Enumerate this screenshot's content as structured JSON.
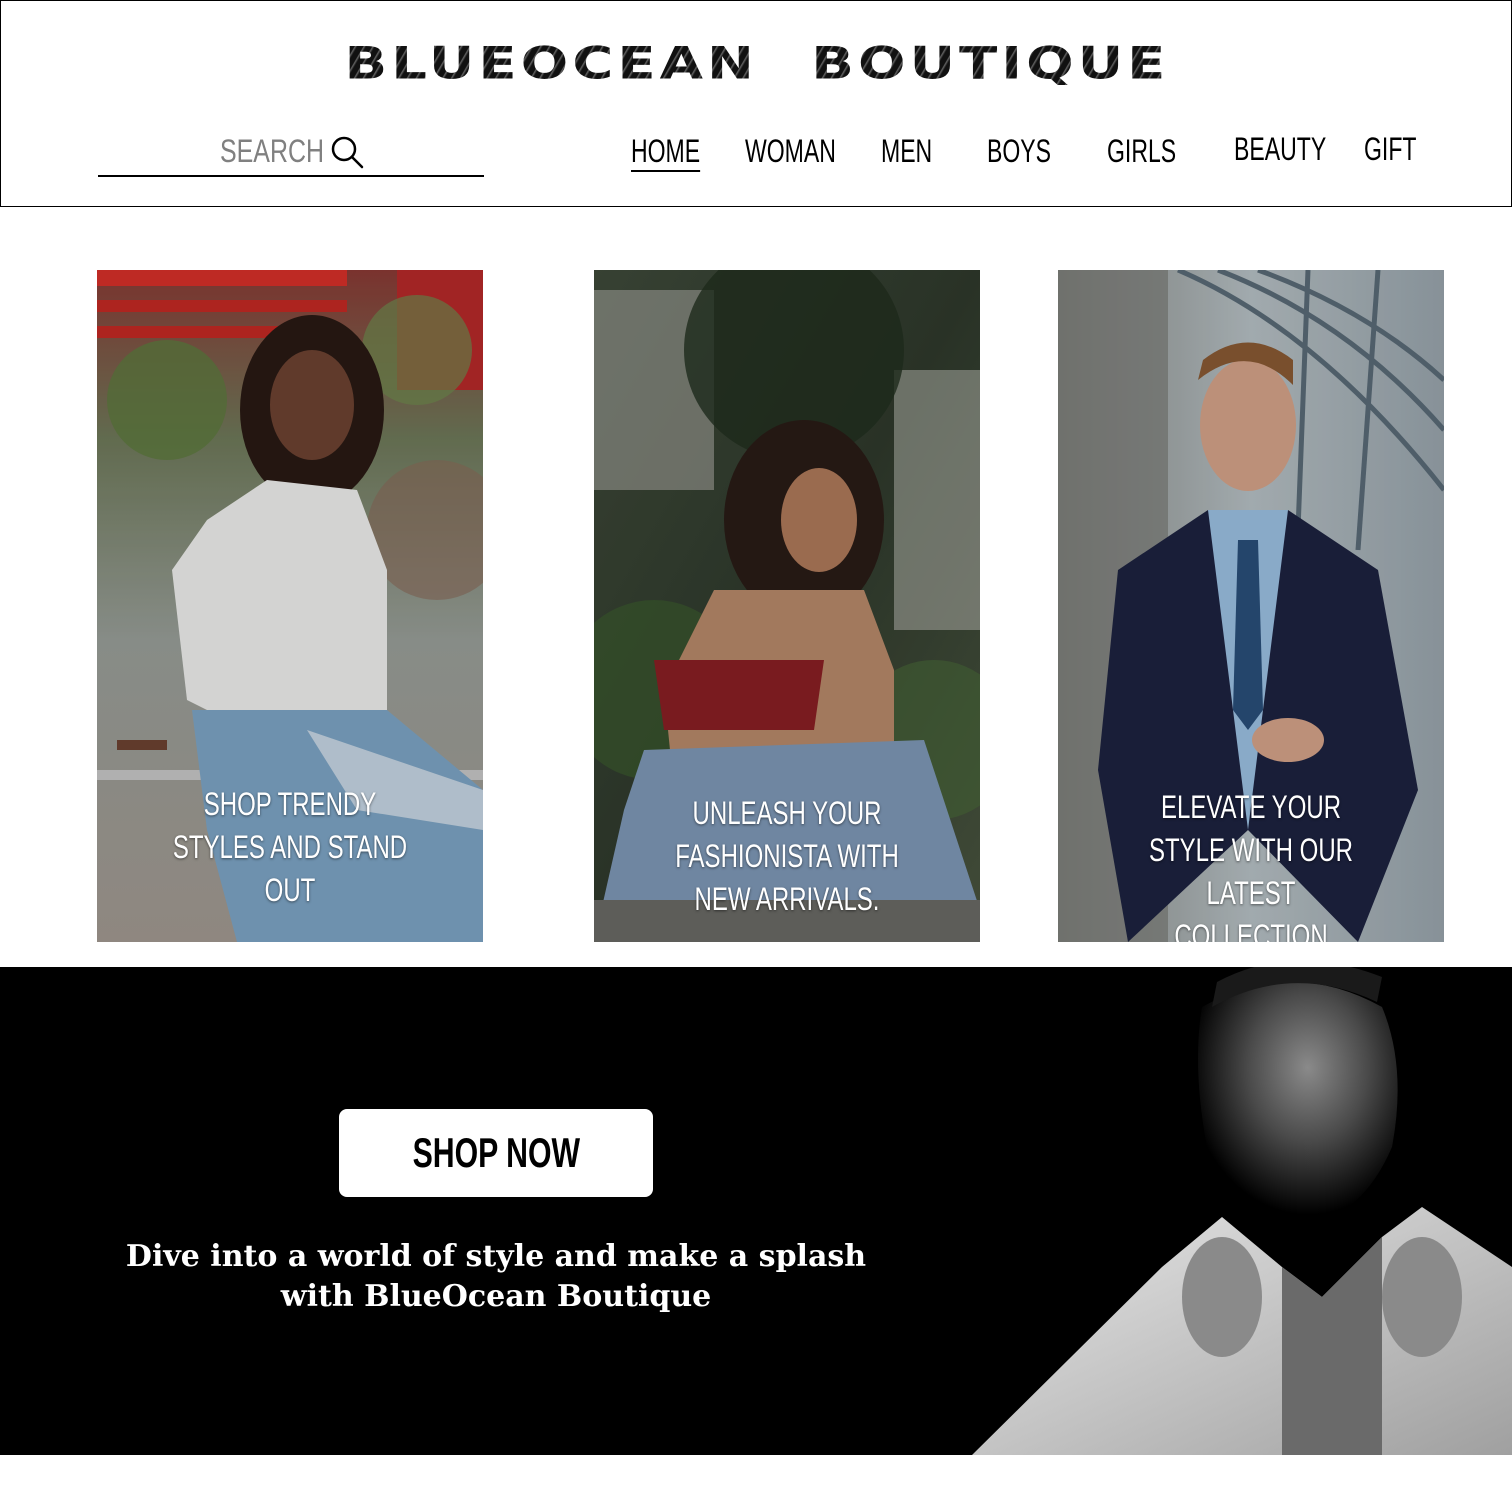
{
  "header": {
    "brand": "BLUEOCEAN BOUTIQUE",
    "search": {
      "label": "SEARCH",
      "icon": "search-icon"
    },
    "nav": [
      {
        "label": "HOME",
        "active": true
      },
      {
        "label": "WOMAN",
        "active": false
      },
      {
        "label": "MEN",
        "active": false
      },
      {
        "label": "BOYS",
        "active": false
      },
      {
        "label": "GIRLS",
        "active": false
      },
      {
        "label": "BEAUTY",
        "active": false
      },
      {
        "label": "GIFT",
        "active": false
      }
    ]
  },
  "cards": [
    {
      "caption": "SHOP TRENDY STYLES AND STAND OUT"
    },
    {
      "caption": "UNLEASH YOUR FASHIONISTA WITH NEW ARRIVALS."
    },
    {
      "caption": "ELEVATE YOUR STYLE WITH OUR LATEST COLLECTION"
    }
  ],
  "banner": {
    "button": "SHOP NOW",
    "tagline": "Dive into a world of style and make a splash with BlueOcean Boutique"
  },
  "colors": {
    "text": "#000000",
    "search_label": "#808080",
    "banner_bg": "#000000",
    "button_bg": "#ffffff"
  }
}
